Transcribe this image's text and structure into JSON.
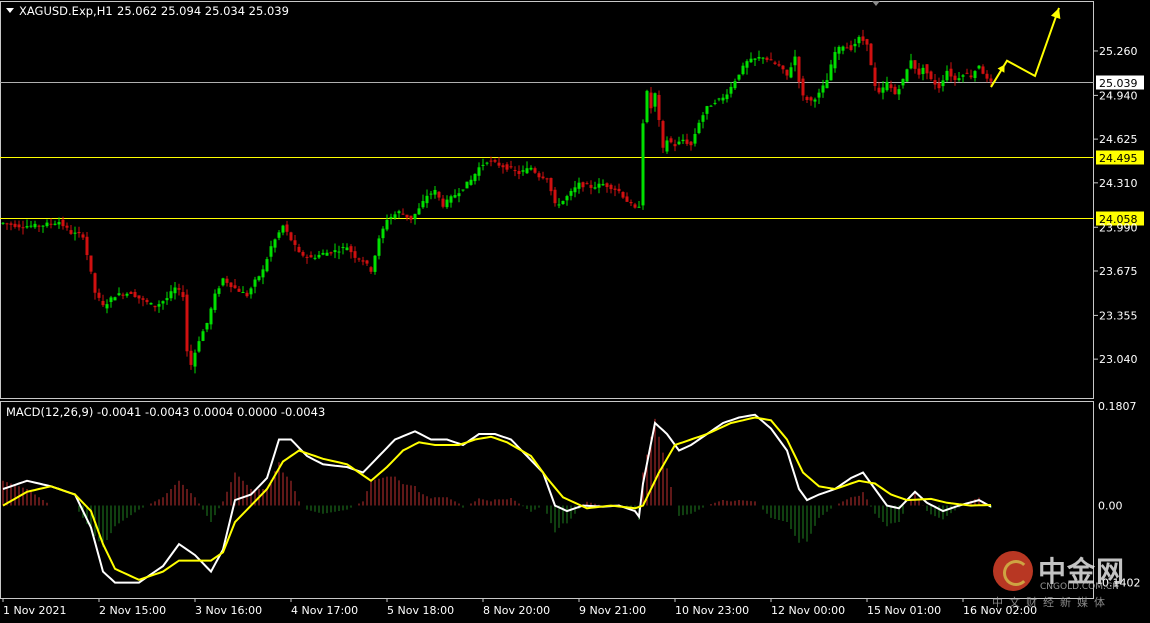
{
  "colors": {
    "background": "#000000",
    "bull": "#00e000",
    "bear": "#d01010",
    "grid_frame": "#c8c8c8",
    "support_line": "#ffff00",
    "current_line": "#b0b0b0",
    "macd_main": "#ffffff",
    "macd_signal": "#ffff00",
    "hist_pos": "#c03030",
    "hist_neg": "#208020",
    "forecast_arrow": "#ffff00"
  },
  "chart_data": [
    {
      "type": "candlestick",
      "symbol_header": "XAGUSD.Exp,H1",
      "ohlc_header": "25.062 25.094 25.034 25.039",
      "timeframe": "H1",
      "last_open": 25.062,
      "last_high": 25.094,
      "last_low": 25.034,
      "last_close": 25.039,
      "y_ticks": [
        25.26,
        24.94,
        24.625,
        24.31,
        23.99,
        23.675,
        23.355,
        23.04
      ],
      "y_tick_labels": [
        "25.260",
        "24.940",
        "24.625",
        "24.310",
        "23.990",
        "23.675",
        "23.355",
        "23.040"
      ],
      "ylim": [
        22.76,
        25.62
      ],
      "current_price_label": "25.039",
      "horizontal_levels": [
        {
          "value": 24.495,
          "label": "24.495"
        },
        {
          "value": 24.058,
          "label": "24.058"
        }
      ],
      "x_tick_labels": [
        "1 Nov 2021",
        "2 Nov 15:00",
        "3 Nov 16:00",
        "4 Nov 17:00",
        "5 Nov 18:00",
        "8 Nov 20:00",
        "9 Nov 21:00",
        "10 Nov 23:00",
        "12 Nov 00:00",
        "15 Nov 01:00",
        "16 Nov 02:00"
      ],
      "price_path_anchors": [
        [
          0,
          24.02
        ],
        [
          4,
          24.0
        ],
        [
          9,
          24.0
        ],
        [
          14,
          24.03
        ],
        [
          17,
          23.95
        ],
        [
          20,
          23.93
        ],
        [
          23,
          23.52
        ],
        [
          25,
          23.42
        ],
        [
          28,
          23.5
        ],
        [
          32,
          23.52
        ],
        [
          35,
          23.46
        ],
        [
          38,
          23.42
        ],
        [
          41,
          23.48
        ],
        [
          43,
          23.55
        ],
        [
          45,
          23.5
        ],
        [
          46,
          23.1
        ],
        [
          47,
          23.0
        ],
        [
          49,
          23.18
        ],
        [
          51,
          23.3
        ],
        [
          53,
          23.5
        ],
        [
          55,
          23.62
        ],
        [
          58,
          23.55
        ],
        [
          61,
          23.5
        ],
        [
          63,
          23.6
        ],
        [
          65,
          23.68
        ],
        [
          67,
          23.85
        ],
        [
          70,
          24.0
        ],
        [
          72,
          23.9
        ],
        [
          74,
          23.8
        ],
        [
          77,
          23.77
        ],
        [
          80,
          23.8
        ],
        [
          83,
          23.82
        ],
        [
          86,
          23.85
        ],
        [
          88,
          23.78
        ],
        [
          90,
          23.75
        ],
        [
          92,
          23.68
        ],
        [
          94,
          23.9
        ],
        [
          96,
          24.05
        ],
        [
          99,
          24.1
        ],
        [
          102,
          24.05
        ],
        [
          104,
          24.12
        ],
        [
          106,
          24.22
        ],
        [
          108,
          24.25
        ],
        [
          110,
          24.15
        ],
        [
          112,
          24.2
        ],
        [
          114,
          24.25
        ],
        [
          117,
          24.33
        ],
        [
          119,
          24.42
        ],
        [
          121,
          24.47
        ],
        [
          123,
          24.45
        ],
        [
          126,
          24.42
        ],
        [
          129,
          24.38
        ],
        [
          132,
          24.42
        ],
        [
          134,
          24.36
        ],
        [
          136,
          24.35
        ],
        [
          138,
          24.15
        ],
        [
          140,
          24.18
        ],
        [
          142,
          24.24
        ],
        [
          144,
          24.3
        ],
        [
          147,
          24.28
        ],
        [
          150,
          24.3
        ],
        [
          152,
          24.28
        ],
        [
          154,
          24.25
        ],
        [
          156,
          24.18
        ],
        [
          158,
          24.12
        ],
        [
          159,
          24.15
        ],
        [
          160,
          24.75
        ],
        [
          161,
          24.96
        ],
        [
          162,
          24.85
        ],
        [
          163,
          24.95
        ],
        [
          164,
          24.75
        ],
        [
          165,
          24.55
        ],
        [
          166,
          24.62
        ],
        [
          168,
          24.58
        ],
        [
          170,
          24.62
        ],
        [
          172,
          24.58
        ],
        [
          174,
          24.75
        ],
        [
          176,
          24.85
        ],
        [
          178,
          24.9
        ],
        [
          180,
          24.92
        ],
        [
          182,
          25.0
        ],
        [
          184,
          25.1
        ],
        [
          186,
          25.18
        ],
        [
          188,
          25.2
        ],
        [
          190,
          25.22
        ],
        [
          192,
          25.18
        ],
        [
          194,
          25.15
        ],
        [
          196,
          25.08
        ],
        [
          198,
          25.22
        ],
        [
          199,
          25.05
        ],
        [
          200,
          24.93
        ],
        [
          202,
          24.9
        ],
        [
          204,
          24.95
        ],
        [
          206,
          25.05
        ],
        [
          208,
          25.25
        ],
        [
          210,
          25.3
        ],
        [
          212,
          25.28
        ],
        [
          214,
          25.35
        ],
        [
          216,
          25.32
        ],
        [
          217,
          25.15
        ],
        [
          218,
          25.0
        ],
        [
          219,
          24.95
        ],
        [
          221,
          25.03
        ],
        [
          223,
          24.95
        ],
        [
          225,
          25.05
        ],
        [
          227,
          25.2
        ],
        [
          229,
          25.08
        ],
        [
          230,
          25.15
        ],
        [
          232,
          25.05
        ],
        [
          234,
          25.0
        ],
        [
          236,
          25.12
        ],
        [
          238,
          25.05
        ],
        [
          240,
          25.1
        ],
        [
          242,
          25.08
        ],
        [
          244,
          25.16
        ],
        [
          246,
          25.05
        ],
        [
          247,
          25.04
        ]
      ],
      "forecast_path": [
        [
          247,
          25.0
        ],
        [
          251,
          25.19
        ],
        [
          258,
          25.08
        ],
        [
          264,
          25.57
        ]
      ]
    },
    {
      "type": "macd",
      "header": "MACD(12,26,9) -0.0041 -0.0043 0.0004 0.0000 -0.0043",
      "params": [
        12,
        26,
        9
      ],
      "values": [
        -0.0041,
        -0.0043,
        0.0004,
        0.0,
        -0.0043
      ],
      "y_tick_labels": [
        "0.1807",
        "0.00",
        "-0.1402"
      ],
      "y_ticks": [
        0.1807,
        0.0,
        -0.1402
      ],
      "ylim": [
        -0.168,
        0.19
      ],
      "main_anchors": [
        [
          0,
          0.03
        ],
        [
          6,
          0.045
        ],
        [
          12,
          0.035
        ],
        [
          18,
          0.02
        ],
        [
          22,
          -0.04
        ],
        [
          25,
          -0.12
        ],
        [
          28,
          -0.14
        ],
        [
          34,
          -0.14
        ],
        [
          40,
          -0.11
        ],
        [
          44,
          -0.07
        ],
        [
          48,
          -0.09
        ],
        [
          52,
          -0.12
        ],
        [
          55,
          -0.08
        ],
        [
          58,
          0.01
        ],
        [
          62,
          0.02
        ],
        [
          66,
          0.05
        ],
        [
          69,
          0.12
        ],
        [
          72,
          0.12
        ],
        [
          76,
          0.09
        ],
        [
          80,
          0.075
        ],
        [
          86,
          0.07
        ],
        [
          90,
          0.06
        ],
        [
          94,
          0.09
        ],
        [
          98,
          0.12
        ],
        [
          103,
          0.135
        ],
        [
          107,
          0.12
        ],
        [
          111,
          0.12
        ],
        [
          115,
          0.11
        ],
        [
          119,
          0.13
        ],
        [
          123,
          0.13
        ],
        [
          127,
          0.12
        ],
        [
          131,
          0.09
        ],
        [
          135,
          0.06
        ],
        [
          138,
          0.0
        ],
        [
          141,
          -0.01
        ],
        [
          145,
          0.0
        ],
        [
          150,
          -0.002
        ],
        [
          154,
          0.0
        ],
        [
          158,
          -0.01
        ],
        [
          159,
          -0.02
        ],
        [
          160,
          0.04
        ],
        [
          163,
          0.15
        ],
        [
          166,
          0.13
        ],
        [
          169,
          0.1
        ],
        [
          172,
          0.11
        ],
        [
          176,
          0.13
        ],
        [
          180,
          0.15
        ],
        [
          184,
          0.16
        ],
        [
          188,
          0.165
        ],
        [
          192,
          0.14
        ],
        [
          196,
          0.1
        ],
        [
          199,
          0.03
        ],
        [
          201,
          0.01
        ],
        [
          204,
          0.02
        ],
        [
          208,
          0.03
        ],
        [
          212,
          0.05
        ],
        [
          215,
          0.06
        ],
        [
          218,
          0.03
        ],
        [
          221,
          0.0
        ],
        [
          224,
          -0.005
        ],
        [
          228,
          0.025
        ],
        [
          231,
          0.005
        ],
        [
          235,
          -0.01
        ],
        [
          239,
          0.0
        ],
        [
          244,
          0.01
        ],
        [
          247,
          -0.002
        ]
      ],
      "signal_anchors": [
        [
          0,
          0.0
        ],
        [
          6,
          0.025
        ],
        [
          12,
          0.035
        ],
        [
          18,
          0.02
        ],
        [
          22,
          -0.01
        ],
        [
          25,
          -0.07
        ],
        [
          28,
          -0.115
        ],
        [
          34,
          -0.135
        ],
        [
          40,
          -0.12
        ],
        [
          44,
          -0.1
        ],
        [
          48,
          -0.1
        ],
        [
          52,
          -0.1
        ],
        [
          55,
          -0.085
        ],
        [
          58,
          -0.03
        ],
        [
          62,
          0.0
        ],
        [
          66,
          0.03
        ],
        [
          70,
          0.08
        ],
        [
          74,
          0.1
        ],
        [
          80,
          0.085
        ],
        [
          86,
          0.075
        ],
        [
          92,
          0.045
        ],
        [
          96,
          0.07
        ],
        [
          100,
          0.1
        ],
        [
          104,
          0.115
        ],
        [
          108,
          0.11
        ],
        [
          114,
          0.11
        ],
        [
          118,
          0.12
        ],
        [
          122,
          0.125
        ],
        [
          126,
          0.115
        ],
        [
          132,
          0.09
        ],
        [
          136,
          0.05
        ],
        [
          140,
          0.015
        ],
        [
          146,
          -0.005
        ],
        [
          152,
          0.0
        ],
        [
          158,
          -0.005
        ],
        [
          160,
          0.0
        ],
        [
          164,
          0.06
        ],
        [
          168,
          0.11
        ],
        [
          172,
          0.12
        ],
        [
          176,
          0.13
        ],
        [
          182,
          0.15
        ],
        [
          188,
          0.16
        ],
        [
          192,
          0.155
        ],
        [
          196,
          0.12
        ],
        [
          200,
          0.06
        ],
        [
          204,
          0.035
        ],
        [
          208,
          0.03
        ],
        [
          214,
          0.045
        ],
        [
          218,
          0.04
        ],
        [
          222,
          0.02
        ],
        [
          226,
          0.01
        ],
        [
          232,
          0.012
        ],
        [
          236,
          0.005
        ],
        [
          242,
          0.0
        ],
        [
          247,
          0.001
        ]
      ]
    }
  ],
  "watermark": {
    "cn": "中金网",
    "en": "CNGOLD.COM.CN",
    "sub": "中文财经新媒体"
  }
}
